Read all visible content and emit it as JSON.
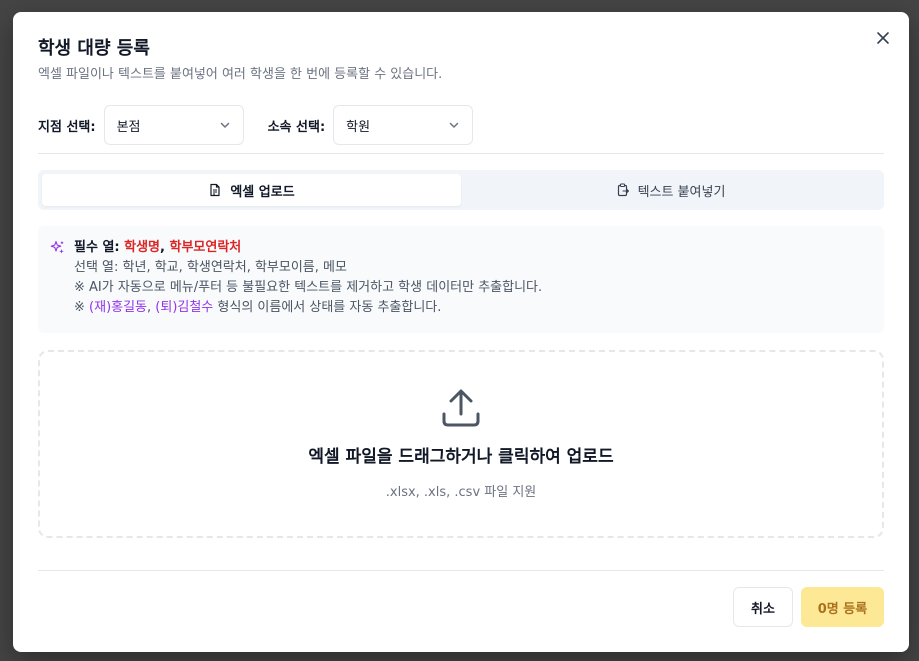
{
  "dialog": {
    "title": "학생 대량 등록",
    "subtitle": "엑셀 파일이나 텍스트를 붙여넣어 여러 학생을 한 번에 등록할 수 있습니다."
  },
  "filters": {
    "branch_label": "지점 선택:",
    "branch_value": "본점",
    "affiliation_label": "소속 선택:",
    "affiliation_value": "학원"
  },
  "tabs": [
    {
      "label": "엑셀 업로드",
      "active": true
    },
    {
      "label": "텍스트 붙여넣기",
      "active": false
    }
  ],
  "info": {
    "required_prefix": "필수 열: ",
    "required_col1": "학생명",
    "required_sep": ", ",
    "required_col2": "학부모연락처",
    "optional": "선택 열: 학년, 학교, 학생연락처, 학부모이름, 메모",
    "ai_note": "※ AI가 자동으로 메뉴/푸터 등 불필요한 텍스트를 제거하고 학생 데이터만 추출합니다.",
    "status_prefix": "※ ",
    "status_ex1": "(재)홍길동",
    "status_sep": ", ",
    "status_ex2": "(퇴)김철수",
    "status_suffix": " 형식의 이름에서 상태를 자동 추출합니다."
  },
  "dropzone": {
    "main": "엑셀 파일을 드래그하거나 클릭하여 업로드",
    "sub": ".xlsx, .xls, .csv 파일 지원"
  },
  "footer": {
    "cancel_label": "취소",
    "submit_label": "0명 등록"
  },
  "colors": {
    "required_highlight": "#dc2626",
    "status_highlight": "#9333ea",
    "submit_bg": "#fde68a"
  }
}
